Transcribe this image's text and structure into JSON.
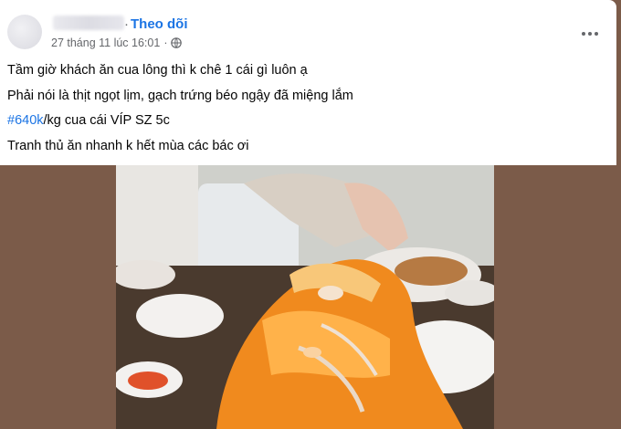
{
  "post": {
    "follow_label": "Theo dõi",
    "separator": "·",
    "timestamp": "27 tháng 11 lúc 16:01",
    "separator2": "·",
    "lines": {
      "l1": "Tầm giờ khách ăn cua lông thì k chê 1 cái gì luôn ạ",
      "l2": "Phải nói là thịt ngọt lịm, gạch trứng béo ngậy đã miệng lắm",
      "l3_hashtag": "#640k",
      "l3_rest": "/kg cua cái VÍP SZ 5c",
      "l4": "Tranh thủ ăn nhanh k hết mùa các bác ơi"
    }
  },
  "colors": {
    "accent": "#1b74e4",
    "background": "#7b5b49",
    "roe": "#f08a1e"
  },
  "icons": [
    "globe-icon",
    "more-options-icon"
  ]
}
